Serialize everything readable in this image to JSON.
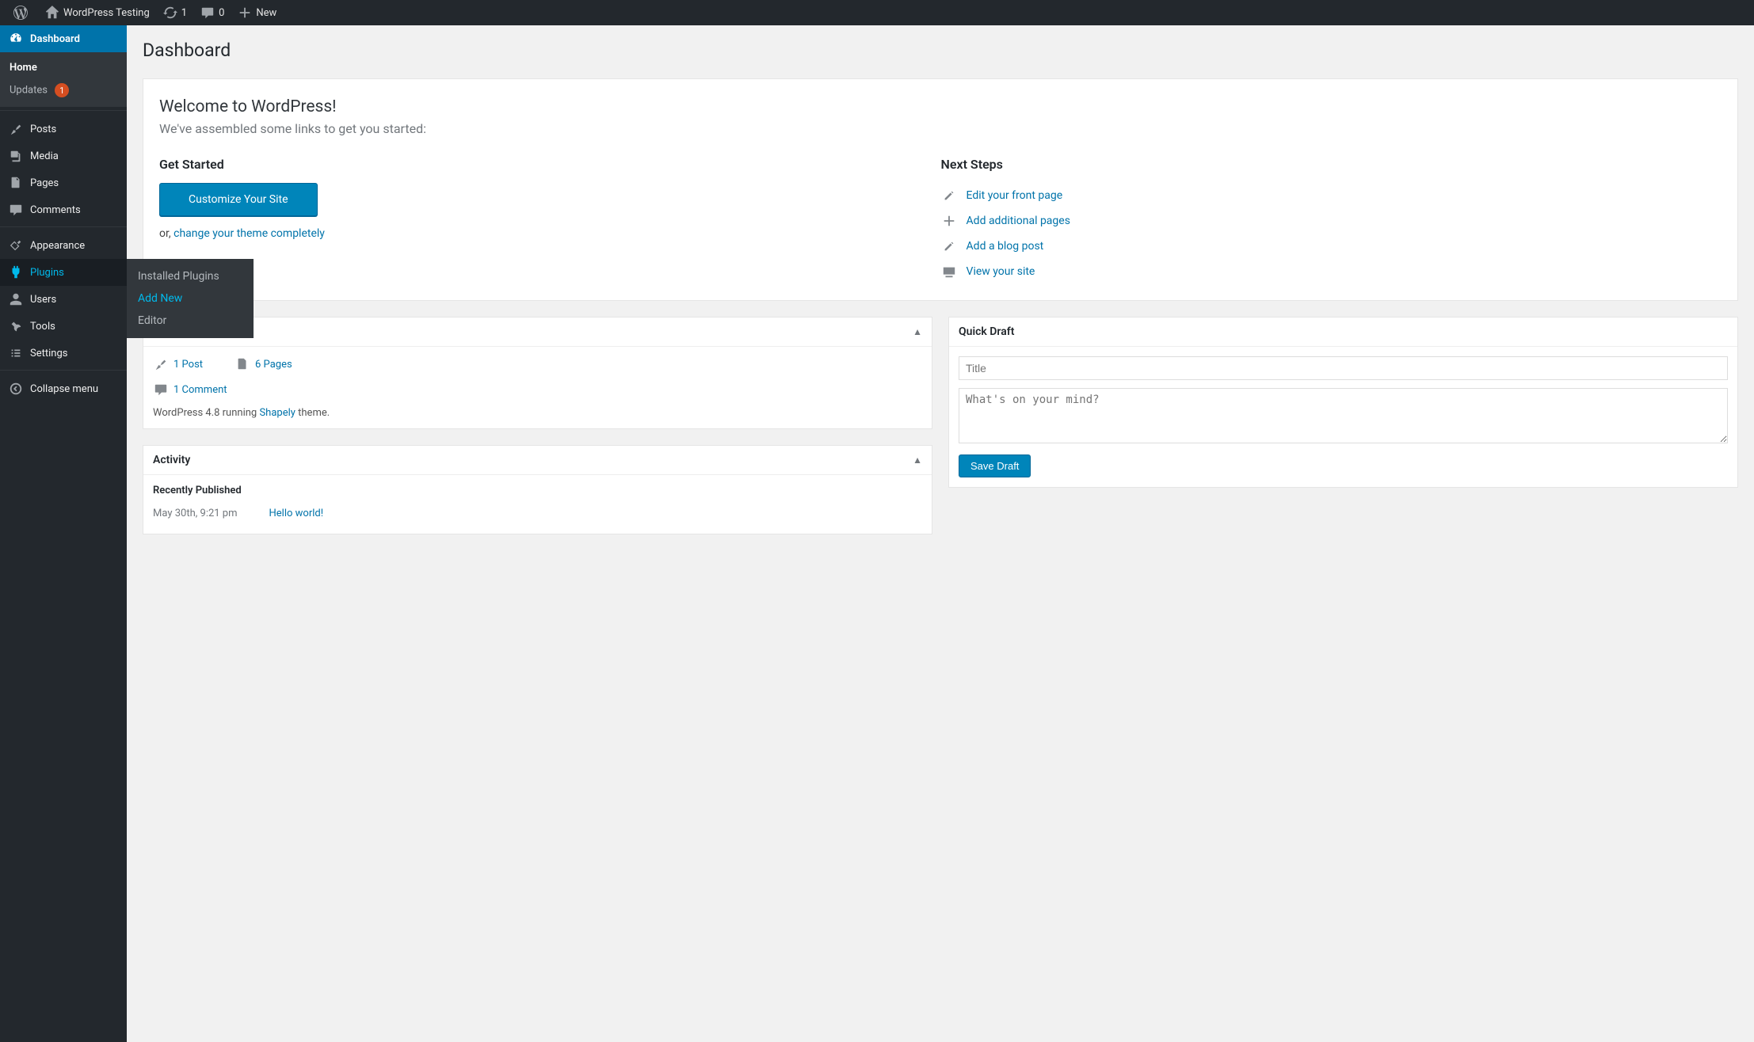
{
  "adminbar": {
    "site_name": "WordPress Testing",
    "updates_count": "1",
    "comments_count": "0",
    "new_label": "New"
  },
  "sidebar": {
    "dashboard": "Dashboard",
    "home": "Home",
    "updates": "Updates",
    "updates_badge": "1",
    "posts": "Posts",
    "media": "Media",
    "pages": "Pages",
    "comments": "Comments",
    "appearance": "Appearance",
    "plugins": "Plugins",
    "users": "Users",
    "tools": "Tools",
    "settings": "Settings",
    "collapse": "Collapse menu"
  },
  "plugins_submenu": {
    "installed": "Installed Plugins",
    "add_new": "Add New",
    "editor": "Editor"
  },
  "heading": "Dashboard",
  "welcome": {
    "title": "Welcome to WordPress!",
    "subtitle": "We've assembled some links to get you started:",
    "get_started": "Get Started",
    "customize_btn": "Customize Your Site",
    "or_prefix": "or, ",
    "or_link": "change your theme completely",
    "next_steps": "Next Steps",
    "edit_front": "Edit your front page",
    "add_pages": "Add additional pages",
    "add_post": "Add a blog post",
    "view_site": "View your site"
  },
  "at_glance": {
    "posts": "1 Post",
    "pages": "6 Pages",
    "comments": "1 Comment",
    "version_prefix": "WordPress 4.8 running ",
    "theme": "Shapely",
    "version_suffix": " theme."
  },
  "activity": {
    "title": "Activity",
    "recently_published": "Recently Published",
    "post_time": "May 30th, 9:21 pm",
    "post_title": "Hello world!"
  },
  "quick_draft": {
    "title": "Quick Draft",
    "title_placeholder": "Title",
    "content_placeholder": "What's on your mind?",
    "save": "Save Draft"
  }
}
